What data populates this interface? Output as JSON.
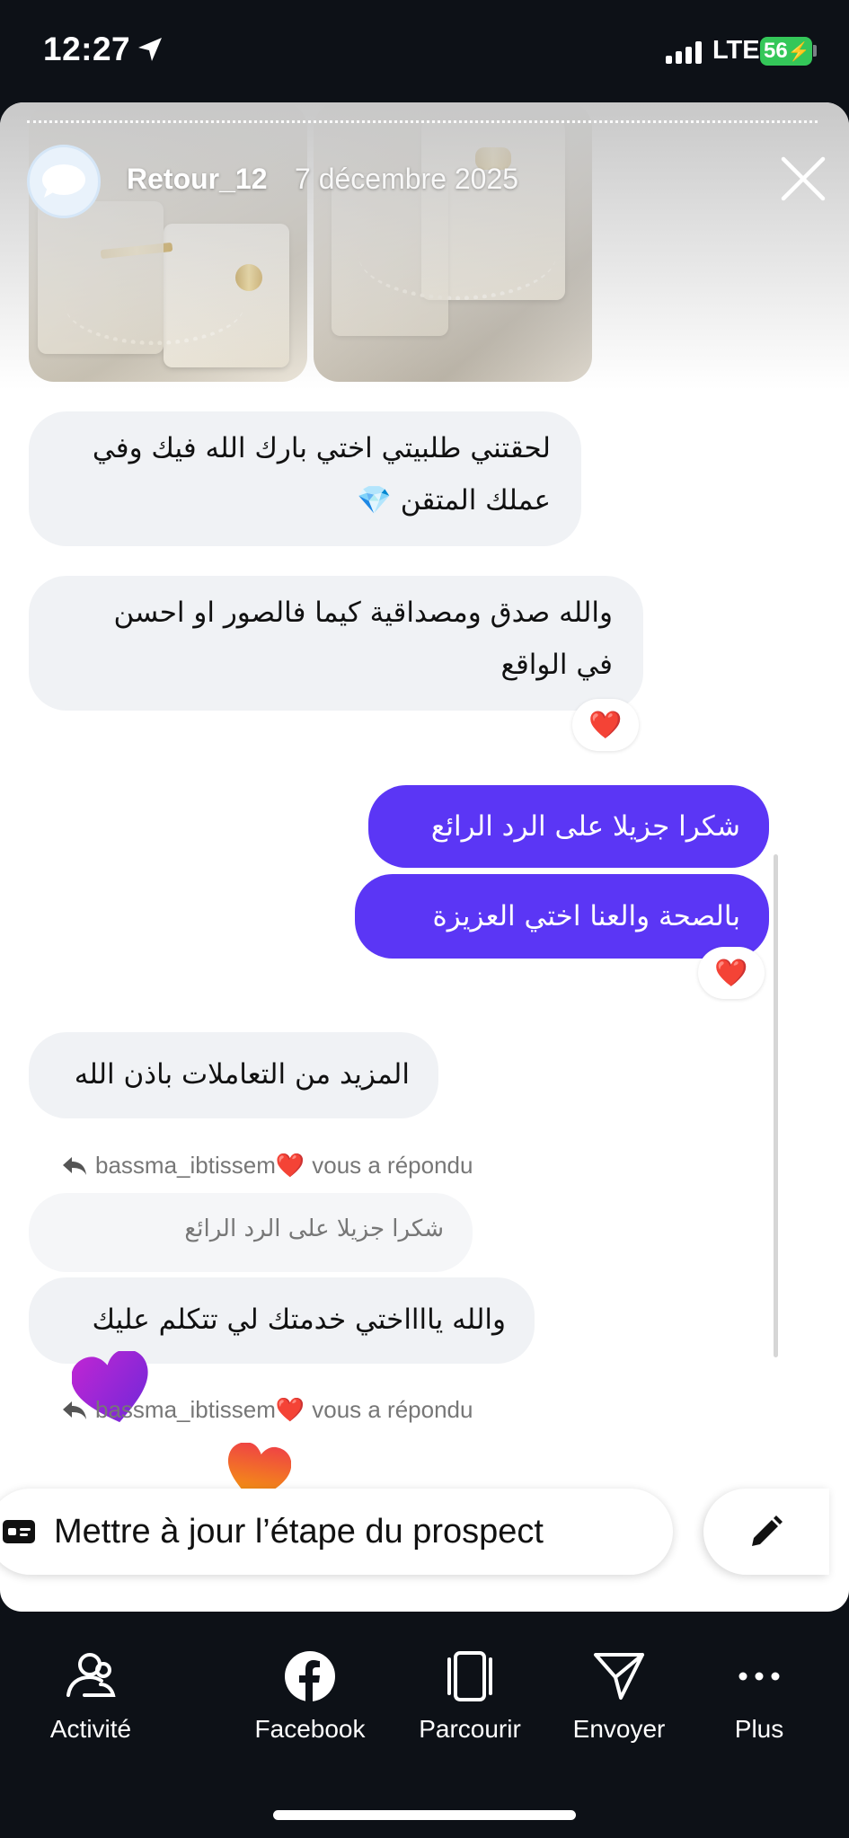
{
  "status_bar": {
    "time": "12:27",
    "network": "LTE",
    "battery": "56"
  },
  "story": {
    "username": "Retour_12",
    "date": "7 décembre 2025"
  },
  "messages": [
    {
      "direction": "incoming",
      "text": "لحقتني طلبيتي اختي بارك الله فيك وفي\nعملك المتقن 💎"
    },
    {
      "direction": "incoming",
      "text": "والله صدق ومصداقية كيما فالصور او احسن\nفي الواقع",
      "reaction": "❤️"
    },
    {
      "direction": "outgoing",
      "text": "شكرا جزيلا على الرد الرائع"
    },
    {
      "direction": "outgoing",
      "text": "بالصحة والعنا اختي العزيزة",
      "reaction": "❤️"
    },
    {
      "direction": "incoming",
      "text": "المزيد من التعاملات باذن الله"
    },
    {
      "direction": "incoming",
      "reply_info": {
        "user": "bassma_ibtissem❤️",
        "suffix": "vous a répondu"
      },
      "quoted": "شكرا جزيلا على الرد الرائع",
      "text": "والله يااااختي خدمتك لي تتكلم عليك"
    },
    {
      "direction": "incoming",
      "reply_info": {
        "user": "bassma_ibtissem❤️",
        "suffix": "vous a répondu"
      }
    }
  ],
  "prospect_button": {
    "label": "Mettre à jour l’étape du prospect"
  },
  "toolbar": {
    "items": [
      {
        "label": "Activité",
        "icon": "activity-icon"
      },
      {
        "label": "Facebook",
        "icon": "facebook-icon"
      },
      {
        "label": "Parcourir",
        "icon": "browse-icon"
      },
      {
        "label": "Envoyer",
        "icon": "send-icon"
      },
      {
        "label": "Plus",
        "icon": "more-icon"
      }
    ]
  },
  "colors": {
    "outgoing_bubble": "#5b36f5",
    "incoming_bubble": "#f0f2f5",
    "background": "#0d1117"
  }
}
